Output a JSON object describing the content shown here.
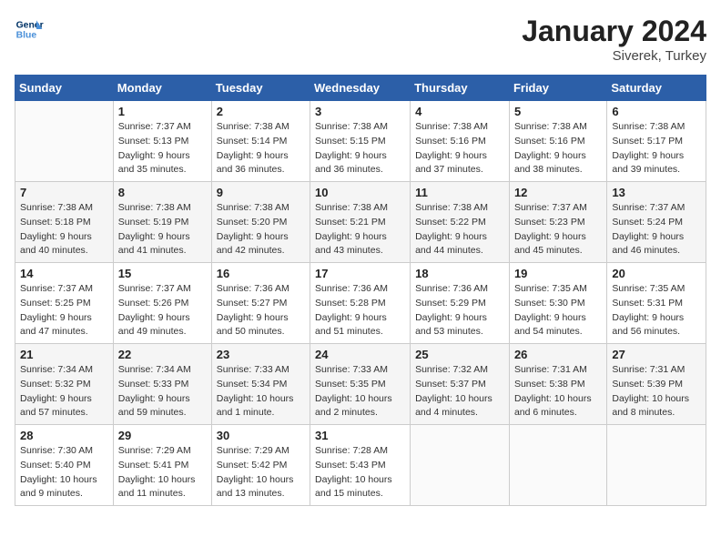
{
  "header": {
    "logo_line1": "General",
    "logo_line2": "Blue",
    "title": "January 2024",
    "subtitle": "Siverek, Turkey"
  },
  "weekdays": [
    "Sunday",
    "Monday",
    "Tuesday",
    "Wednesday",
    "Thursday",
    "Friday",
    "Saturday"
  ],
  "weeks": [
    [
      {
        "day": "",
        "sunrise": "",
        "sunset": "",
        "daylight": ""
      },
      {
        "day": "1",
        "sunrise": "Sunrise: 7:37 AM",
        "sunset": "Sunset: 5:13 PM",
        "daylight": "Daylight: 9 hours and 35 minutes."
      },
      {
        "day": "2",
        "sunrise": "Sunrise: 7:38 AM",
        "sunset": "Sunset: 5:14 PM",
        "daylight": "Daylight: 9 hours and 36 minutes."
      },
      {
        "day": "3",
        "sunrise": "Sunrise: 7:38 AM",
        "sunset": "Sunset: 5:15 PM",
        "daylight": "Daylight: 9 hours and 36 minutes."
      },
      {
        "day": "4",
        "sunrise": "Sunrise: 7:38 AM",
        "sunset": "Sunset: 5:16 PM",
        "daylight": "Daylight: 9 hours and 37 minutes."
      },
      {
        "day": "5",
        "sunrise": "Sunrise: 7:38 AM",
        "sunset": "Sunset: 5:16 PM",
        "daylight": "Daylight: 9 hours and 38 minutes."
      },
      {
        "day": "6",
        "sunrise": "Sunrise: 7:38 AM",
        "sunset": "Sunset: 5:17 PM",
        "daylight": "Daylight: 9 hours and 39 minutes."
      }
    ],
    [
      {
        "day": "7",
        "sunrise": "Sunrise: 7:38 AM",
        "sunset": "Sunset: 5:18 PM",
        "daylight": "Daylight: 9 hours and 40 minutes."
      },
      {
        "day": "8",
        "sunrise": "Sunrise: 7:38 AM",
        "sunset": "Sunset: 5:19 PM",
        "daylight": "Daylight: 9 hours and 41 minutes."
      },
      {
        "day": "9",
        "sunrise": "Sunrise: 7:38 AM",
        "sunset": "Sunset: 5:20 PM",
        "daylight": "Daylight: 9 hours and 42 minutes."
      },
      {
        "day": "10",
        "sunrise": "Sunrise: 7:38 AM",
        "sunset": "Sunset: 5:21 PM",
        "daylight": "Daylight: 9 hours and 43 minutes."
      },
      {
        "day": "11",
        "sunrise": "Sunrise: 7:38 AM",
        "sunset": "Sunset: 5:22 PM",
        "daylight": "Daylight: 9 hours and 44 minutes."
      },
      {
        "day": "12",
        "sunrise": "Sunrise: 7:37 AM",
        "sunset": "Sunset: 5:23 PM",
        "daylight": "Daylight: 9 hours and 45 minutes."
      },
      {
        "day": "13",
        "sunrise": "Sunrise: 7:37 AM",
        "sunset": "Sunset: 5:24 PM",
        "daylight": "Daylight: 9 hours and 46 minutes."
      }
    ],
    [
      {
        "day": "14",
        "sunrise": "Sunrise: 7:37 AM",
        "sunset": "Sunset: 5:25 PM",
        "daylight": "Daylight: 9 hours and 47 minutes."
      },
      {
        "day": "15",
        "sunrise": "Sunrise: 7:37 AM",
        "sunset": "Sunset: 5:26 PM",
        "daylight": "Daylight: 9 hours and 49 minutes."
      },
      {
        "day": "16",
        "sunrise": "Sunrise: 7:36 AM",
        "sunset": "Sunset: 5:27 PM",
        "daylight": "Daylight: 9 hours and 50 minutes."
      },
      {
        "day": "17",
        "sunrise": "Sunrise: 7:36 AM",
        "sunset": "Sunset: 5:28 PM",
        "daylight": "Daylight: 9 hours and 51 minutes."
      },
      {
        "day": "18",
        "sunrise": "Sunrise: 7:36 AM",
        "sunset": "Sunset: 5:29 PM",
        "daylight": "Daylight: 9 hours and 53 minutes."
      },
      {
        "day": "19",
        "sunrise": "Sunrise: 7:35 AM",
        "sunset": "Sunset: 5:30 PM",
        "daylight": "Daylight: 9 hours and 54 minutes."
      },
      {
        "day": "20",
        "sunrise": "Sunrise: 7:35 AM",
        "sunset": "Sunset: 5:31 PM",
        "daylight": "Daylight: 9 hours and 56 minutes."
      }
    ],
    [
      {
        "day": "21",
        "sunrise": "Sunrise: 7:34 AM",
        "sunset": "Sunset: 5:32 PM",
        "daylight": "Daylight: 9 hours and 57 minutes."
      },
      {
        "day": "22",
        "sunrise": "Sunrise: 7:34 AM",
        "sunset": "Sunset: 5:33 PM",
        "daylight": "Daylight: 9 hours and 59 minutes."
      },
      {
        "day": "23",
        "sunrise": "Sunrise: 7:33 AM",
        "sunset": "Sunset: 5:34 PM",
        "daylight": "Daylight: 10 hours and 1 minute."
      },
      {
        "day": "24",
        "sunrise": "Sunrise: 7:33 AM",
        "sunset": "Sunset: 5:35 PM",
        "daylight": "Daylight: 10 hours and 2 minutes."
      },
      {
        "day": "25",
        "sunrise": "Sunrise: 7:32 AM",
        "sunset": "Sunset: 5:37 PM",
        "daylight": "Daylight: 10 hours and 4 minutes."
      },
      {
        "day": "26",
        "sunrise": "Sunrise: 7:31 AM",
        "sunset": "Sunset: 5:38 PM",
        "daylight": "Daylight: 10 hours and 6 minutes."
      },
      {
        "day": "27",
        "sunrise": "Sunrise: 7:31 AM",
        "sunset": "Sunset: 5:39 PM",
        "daylight": "Daylight: 10 hours and 8 minutes."
      }
    ],
    [
      {
        "day": "28",
        "sunrise": "Sunrise: 7:30 AM",
        "sunset": "Sunset: 5:40 PM",
        "daylight": "Daylight: 10 hours and 9 minutes."
      },
      {
        "day": "29",
        "sunrise": "Sunrise: 7:29 AM",
        "sunset": "Sunset: 5:41 PM",
        "daylight": "Daylight: 10 hours and 11 minutes."
      },
      {
        "day": "30",
        "sunrise": "Sunrise: 7:29 AM",
        "sunset": "Sunset: 5:42 PM",
        "daylight": "Daylight: 10 hours and 13 minutes."
      },
      {
        "day": "31",
        "sunrise": "Sunrise: 7:28 AM",
        "sunset": "Sunset: 5:43 PM",
        "daylight": "Daylight: 10 hours and 15 minutes."
      },
      {
        "day": "",
        "sunrise": "",
        "sunset": "",
        "daylight": ""
      },
      {
        "day": "",
        "sunrise": "",
        "sunset": "",
        "daylight": ""
      },
      {
        "day": "",
        "sunrise": "",
        "sunset": "",
        "daylight": ""
      }
    ]
  ]
}
